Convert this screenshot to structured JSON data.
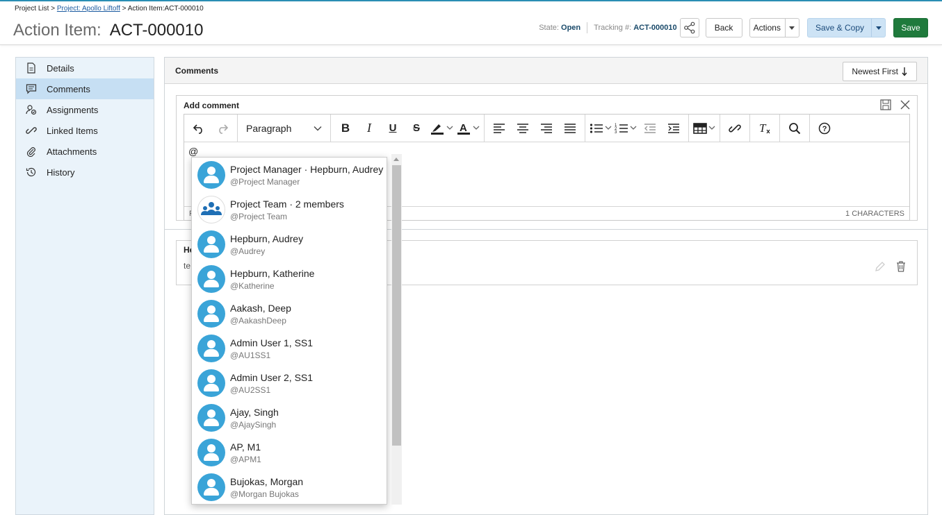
{
  "breadcrumb": {
    "project_list": "Project List",
    "sep1": ">",
    "project": "Project: Apollo Liftoff",
    "sep2": ">",
    "current": "Action Item:ACT-000010"
  },
  "title": {
    "label": "Action Item:",
    "id": "ACT-000010"
  },
  "header": {
    "state_label": "State:",
    "state_value": "Open",
    "tracking_label": "Tracking #:",
    "tracking_value": "ACT-000010",
    "back": "Back",
    "actions": "Actions",
    "save_copy": "Save & Copy",
    "save": "Save",
    "accent_color": "#1f7a3c",
    "save_copy_color": "#cde3f5"
  },
  "sidebar": {
    "items": [
      {
        "label": "Details",
        "icon": "document-icon"
      },
      {
        "label": "Comments",
        "icon": "comment-icon",
        "active": true
      },
      {
        "label": "Assignments",
        "icon": "assignments-icon"
      },
      {
        "label": "Linked Items",
        "icon": "link-icon"
      },
      {
        "label": "Attachments",
        "icon": "paperclip-icon"
      },
      {
        "label": "History",
        "icon": "history-icon"
      }
    ]
  },
  "comments": {
    "title": "Comments",
    "sort": "Newest First",
    "add_label": "Add comment",
    "paragraph": "Paragraph",
    "editor_text": "@",
    "char_count": "1 CHARACTERS",
    "footer_left": "P",
    "existing": {
      "author": "He",
      "text": "te"
    }
  },
  "mentions": [
    {
      "name": "Project Manager · Hepburn, Audrey",
      "handle": "@Project Manager",
      "type": "person"
    },
    {
      "name": "Project Team · 2 members",
      "handle": "@Project Team",
      "type": "team"
    },
    {
      "name": "Hepburn, Audrey",
      "handle": "@Audrey",
      "type": "person"
    },
    {
      "name": "Hepburn, Katherine",
      "handle": "@Katherine",
      "type": "person"
    },
    {
      "name": "Aakash, Deep",
      "handle": "@AakashDeep",
      "type": "person"
    },
    {
      "name": "Admin User 1, SS1",
      "handle": "@AU1SS1",
      "type": "person"
    },
    {
      "name": "Admin User 2, SS1",
      "handle": "@AU2SS1",
      "type": "person"
    },
    {
      "name": "Ajay, Singh",
      "handle": "@AjaySingh",
      "type": "person"
    },
    {
      "name": "AP, M1",
      "handle": "@APM1",
      "type": "person"
    },
    {
      "name": "Bujokas, Morgan",
      "handle": "@Morgan Bujokas",
      "type": "person"
    }
  ]
}
